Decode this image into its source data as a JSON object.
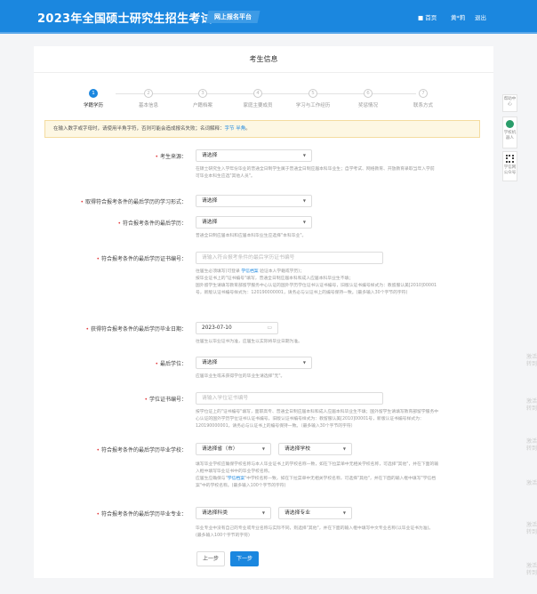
{
  "header": {
    "title": "2023年全国硕士研究生招生考试",
    "badge": "网上报名平台",
    "nav": [
      {
        "icon": "home-icon",
        "label": "首页"
      },
      {
        "label": "黄*莉"
      },
      {
        "label": "退出"
      }
    ]
  },
  "page_title": "考生信息",
  "steps": [
    {
      "num": "1",
      "label": "学籍学历",
      "active": true
    },
    {
      "num": "2",
      "label": "基本信息"
    },
    {
      "num": "3",
      "label": "户籍档案"
    },
    {
      "num": "4",
      "label": "家庭主要成员"
    },
    {
      "num": "5",
      "label": "学习与工作经历"
    },
    {
      "num": "6",
      "label": "奖惩情况"
    },
    {
      "num": "7",
      "label": "联系方式"
    }
  ],
  "notice": {
    "text": "在输入数字或字母时，请使用半角字符，否则可能会造成报名失败；名词解释：",
    "link1": "字节",
    "link2": "半角",
    "end": "。"
  },
  "form": {
    "source": {
      "label": "考生来源：",
      "value": "请选择",
      "hint": "在硕士研究生入学年份毕业的普通全日制学生属于普通全日制应届本科毕业生；自学考试、网络教育、开放教育录取当年入学前可毕业本科生应选\"其他人员\"。"
    },
    "study_form": {
      "label": "取得符合报考条件的最后学历的学习形式：",
      "value": "请选择"
    },
    "last_edu": {
      "label": "符合报考条件的最后学历：",
      "value": "请选择",
      "hint": "普通全日制应届本科和应届本科毕业生应选择\"本科毕业\"。"
    },
    "cert_no": {
      "label": "符合报考条件的最后学历证书编号：",
      "placeholder": "请输入符合报考条件的最后学历证书编号",
      "hint_pre": "往届生必须填写(可登录 ",
      "hint_link": "学信档案",
      "hint_post": " 验证本人学籍或学历)；",
      "hint2": "按毕业证书上的\"证书编号\"填写，普通全日制应届本科和成人应届本科毕业生不填；",
      "hint3": "国外留学生请填写教育部留学服务中心认证的国外学历学位证书认证书编号，旧版认证书编号样式为：教留服认美[2010]00001号，新版认证书编号样式为：120190000001，请务必与认证书上的编号保持一致。(最多输入30个字节的字符)"
    },
    "grad_date": {
      "label": "获得符合报考条件的最后学历毕业日期：",
      "value": "2023-07-10",
      "hint": "往届生以毕业证书为准，应届生以实际将毕业日期为准。"
    },
    "degree": {
      "label": "最后学位：",
      "value": "请选择",
      "hint": "应届毕业生或未获得学位的毕业生请选择\"无\"。"
    },
    "degree_no": {
      "label": "学位证书编号：",
      "placeholder": "请输入学位证书编号",
      "hint": "按学位证上的\"证书编号\"填写，面职高专、普通全日制应届本科和成人应届本科毕业生不填；国外留学生请填写教育部留学服务中心认证的国外学历学位证书认证书编号，旧版认证书编号样式为：教留服认美[2010]00001号，新版认证书编号样式为：120190000001，请务必与认证书上的编号保持一致。（最多输入30个字节的字符）"
    },
    "school": {
      "label": "符合报考条件的最后学历毕业学校：",
      "province": "请选择省（市）",
      "school": "请选择学校",
      "hint1": "填写毕业学校应确保学校名称与本人毕业证书上的学校名称一致，如在下拉菜单中无相关学校名称，可选择\"其他\"，并在下面的输入框中填写毕业证书中的毕业学校名称。",
      "hint2_pre": "应届生应确保与\"",
      "hint2_link": "学信档案",
      "hint2_post": "\"中学校名称一致，如在下拉菜单中无相关学校名称，可选择\"其他\"，并在下面的输入框中填写\"学信档案\"中的学校名称。(最多输入100个字节的字符)"
    },
    "major": {
      "label": "符合报考条件的最后学历毕业专业：",
      "category": "请选择科类",
      "major": "请选择专业",
      "hint": "毕业专业中没有自己的专业或专业名称与实际不同，则选择\"其他\"，并在下面的输入框中填写中文专业名称(以毕业证书为准)。(最多输入100个字节的字符)"
    }
  },
  "buttons": {
    "prev": "上一步",
    "next": "下一步"
  },
  "sidebar": [
    {
      "label": "帮助中心"
    },
    {
      "icon": "robot-icon",
      "label": "学校机器人"
    },
    {
      "icon": "qrcode-icon",
      "label": "学信网公众号"
    }
  ],
  "watermark": {
    "line1": "激活",
    "line2": "转到"
  },
  "colors": {
    "primary": "#1b87df",
    "required": "#e4393c",
    "notice_bg": "#fdf7e3"
  }
}
